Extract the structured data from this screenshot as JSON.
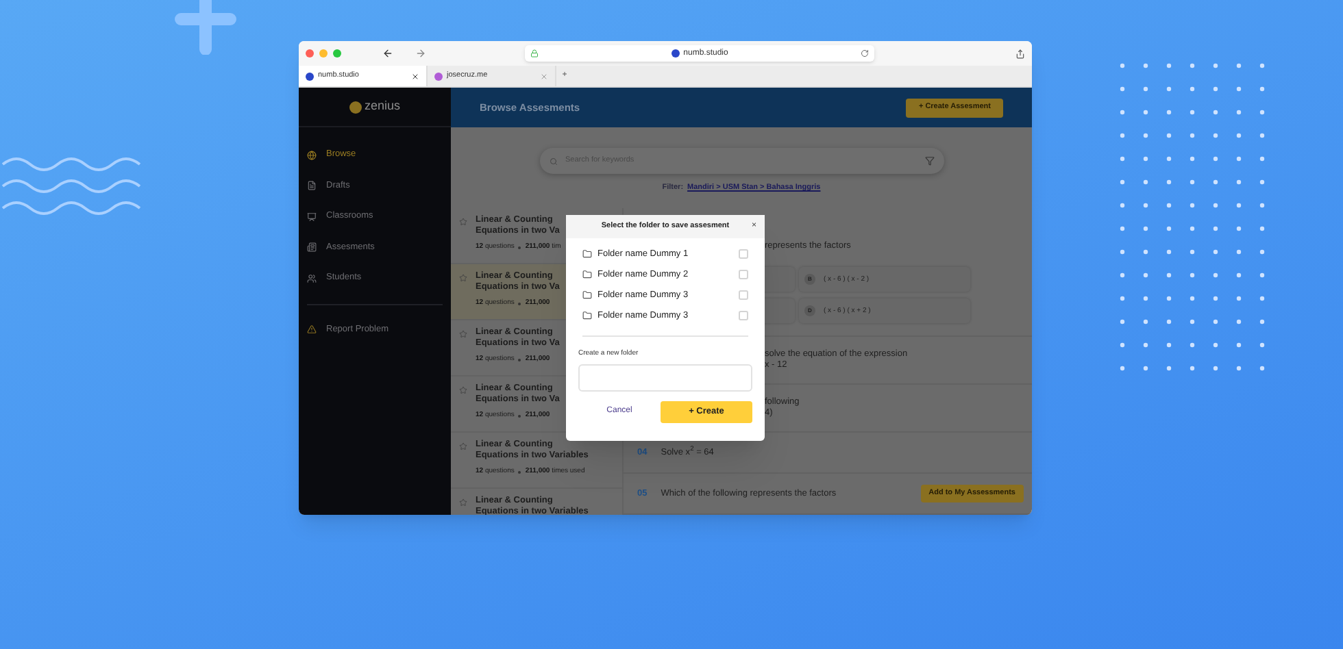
{
  "browser": {
    "address": "numb.studio",
    "tabs": [
      {
        "label": "numb.studio",
        "selected": true
      },
      {
        "label": "josecruz.me",
        "selected": false
      }
    ],
    "new_tab": "+"
  },
  "sidebar": {
    "logo": "zenius",
    "items": [
      {
        "label": "Browse",
        "selected": true
      },
      {
        "label": "Drafts",
        "selected": false
      },
      {
        "label": "Classrooms",
        "selected": false
      },
      {
        "label": "Assesments",
        "selected": false
      },
      {
        "label": "Students",
        "selected": false
      }
    ],
    "footer_item": {
      "label": "Report Problem"
    }
  },
  "header": {
    "title": "Browse Assesments",
    "button": "+ Create Assesment"
  },
  "search": {
    "placeholder": "Search for keywords"
  },
  "filter": {
    "label": "Filter:",
    "path": "Mandiri > USM Stan > Bahasa Inggris"
  },
  "assessments": [
    {
      "title": "Linear & Counting\nEquations  in two Va",
      "count": "12",
      "count_label": "questions",
      "uses": "211,000",
      "uses_label": "tim",
      "selected": false
    },
    {
      "title": "Linear & Counting\nEquations  in two Va",
      "count": "12",
      "count_label": "questions",
      "uses": "211,000",
      "selected": true
    },
    {
      "title": "Linear & Counting\nEquations  in two Va",
      "count": "12",
      "count_label": "questions",
      "uses": "211,000",
      "selected": false
    },
    {
      "title": "Linear & Counting\nEquations  in two Va",
      "count": "12",
      "count_label": "questions",
      "uses": "211,000",
      "selected": false
    },
    {
      "title": "Linear & Counting\nEquations  in two Variables",
      "count": "12",
      "count_label": "questions",
      "uses": "211,000",
      "uses_label": "times used",
      "selected": false
    },
    {
      "title": "Linear & Counting\nEquations  in two Variables",
      "selected": false
    }
  ],
  "questions": [
    {
      "kind": "partial",
      "lines": [
        "represents the factors"
      ],
      "options": [
        {
          "letter": "B",
          "text": "( x - 6 ) ( x - 2 )"
        },
        {
          "letter": "D",
          "text": "( x - 6 ) ( x + 2 )"
        }
      ]
    },
    {
      "kind": "partial",
      "lines": [
        "solve the equation of the expression",
        "x - 12"
      ]
    },
    {
      "kind": "partial",
      "lines": [
        "following",
        "4)"
      ]
    },
    {
      "kind": "full",
      "number": "04",
      "text": "Solve x$^{2}$ = 64"
    },
    {
      "kind": "full",
      "number": "05",
      "text": "Which of the following represents the factors",
      "button": "Add to My Assessments"
    }
  ],
  "dialog": {
    "title": "Select the folder to save assesment",
    "close": "×",
    "folders": [
      {
        "name": "Folder name Dummy 1",
        "checked": false
      },
      {
        "name": "Folder name Dummy 2",
        "checked": false
      },
      {
        "name": "Folder name Dummy 3",
        "checked": false
      },
      {
        "name": "Folder name Dummy 3",
        "checked": false
      }
    ],
    "new_folder_label": "Create a new folder",
    "cancel": "Cancel",
    "create": "+ Create"
  }
}
